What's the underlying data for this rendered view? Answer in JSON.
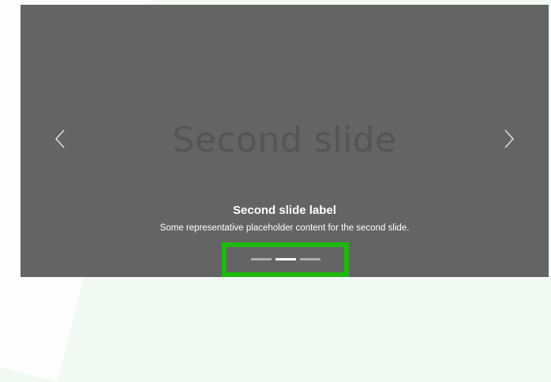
{
  "slide": {
    "placeholder_text": "Second slide",
    "caption_label": "Second slide label",
    "caption_text": "Some representative placeholder content for the second slide."
  },
  "controls": {
    "prev_icon": "chevron-left-icon",
    "next_icon": "chevron-right-icon"
  },
  "indicators": {
    "count": 3,
    "active_index": 1
  },
  "colors": {
    "slide_bg": "#646464",
    "placeholder_text": "#555555",
    "highlight_border": "#1fb80d"
  }
}
